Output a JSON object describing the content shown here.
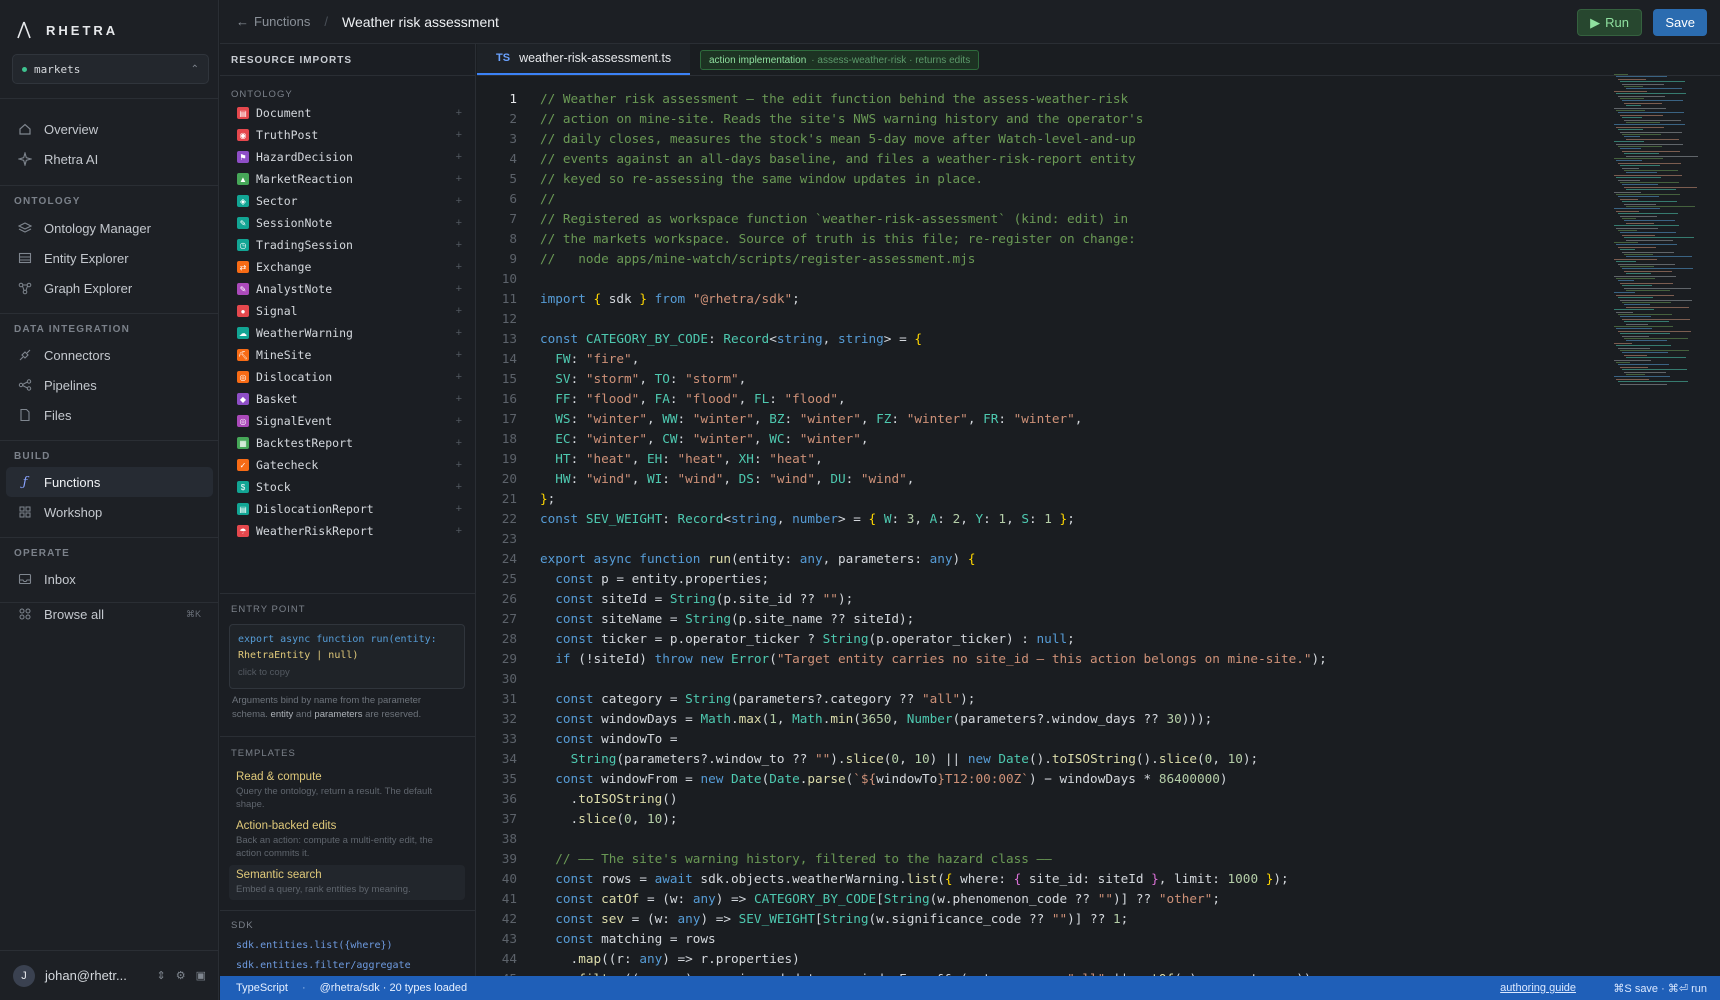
{
  "app": {
    "brand": "RHETRA",
    "workspace": "markets"
  },
  "nav": {
    "overview": "Overview",
    "ai": "Rhetra AI",
    "sections": {
      "ontology": "ONTOLOGY",
      "data": "DATA INTEGRATION",
      "build": "BUILD",
      "operate": "OPERATE"
    },
    "ontology_manager": "Ontology Manager",
    "entity_explorer": "Entity Explorer",
    "graph_explorer": "Graph Explorer",
    "connectors": "Connectors",
    "pipelines": "Pipelines",
    "files": "Files",
    "functions": "Functions",
    "workshop": "Workshop",
    "inbox": "Inbox",
    "browse_all": "Browse all",
    "browse_kbd": "⌘K",
    "user": "johan@rhetr..."
  },
  "header": {
    "back": "Functions",
    "title": "Weather risk assessment",
    "run": "Run",
    "save": "Save"
  },
  "resources": {
    "title": "RESOURCE IMPORTS",
    "ontology_label": "ONTOLOGY",
    "objects": [
      {
        "name": "Document",
        "color": "#e5484d"
      },
      {
        "name": "TruthPost",
        "color": "#e5484d"
      },
      {
        "name": "HazardDecision",
        "color": "#8e4ec6"
      },
      {
        "name": "MarketReaction",
        "color": "#46a758"
      },
      {
        "name": "Sector",
        "color": "#12a594"
      },
      {
        "name": "SessionNote",
        "color": "#12a594"
      },
      {
        "name": "TradingSession",
        "color": "#12a594"
      },
      {
        "name": "Exchange",
        "color": "#f76b15"
      },
      {
        "name": "AnalystNote",
        "color": "#ab4aba"
      },
      {
        "name": "Signal",
        "color": "#e5484d"
      },
      {
        "name": "WeatherWarning",
        "color": "#12a594"
      },
      {
        "name": "MineSite",
        "color": "#f76b15"
      },
      {
        "name": "Dislocation",
        "color": "#f76b15"
      },
      {
        "name": "Basket",
        "color": "#8e4ec6"
      },
      {
        "name": "SignalEvent",
        "color": "#ab4aba"
      },
      {
        "name": "BacktestReport",
        "color": "#46a758"
      },
      {
        "name": "Gatecheck",
        "color": "#f76b15"
      },
      {
        "name": "Stock",
        "color": "#12a594"
      },
      {
        "name": "DislocationReport",
        "color": "#12a594"
      },
      {
        "name": "WeatherRiskReport",
        "color": "#e5484d"
      }
    ],
    "entry_label": "ENTRY POINT",
    "entry_code_1": "export async function run(entity:",
    "entry_code_2": "RhetraEntity | null)",
    "entry_hint": "click to copy",
    "entry_note_1": "Arguments bind by name from the parameter",
    "entry_note_2": "schema.",
    "entry_note_entity": "entity",
    "entry_note_and": "and",
    "entry_note_params": "parameters",
    "entry_note_3": "are reserved.",
    "templates_label": "TEMPLATES",
    "templates": [
      {
        "title": "Read & compute",
        "desc": "Query the ontology, return a result. The default shape."
      },
      {
        "title": "Action-backed edits",
        "desc": "Back an action: compute a multi-entity edit, the action commits it."
      },
      {
        "title": "Semantic search",
        "desc": "Embed a query, rank entities by meaning."
      }
    ],
    "sdk_label": "SDK",
    "sdk_1": "sdk.entities.list({where})",
    "sdk_2": "sdk.entities.filter/aggregate"
  },
  "editor": {
    "tab_lang": "TS",
    "tab_file": "weather-risk-assessment.ts",
    "badge_main": "action implementation",
    "badge_sub": "· assess-weather-risk · returns edits",
    "current_line": 1
  },
  "status": {
    "lang": "TypeScript",
    "sdk": "@rhetra/sdk · 20 types loaded",
    "guide": "authoring guide",
    "keys": "⌘S save · ⌘⏎ run"
  },
  "colors": {
    "accent": "#3b82f6",
    "run": "#8fe09f",
    "status": "#1f5fb8"
  }
}
